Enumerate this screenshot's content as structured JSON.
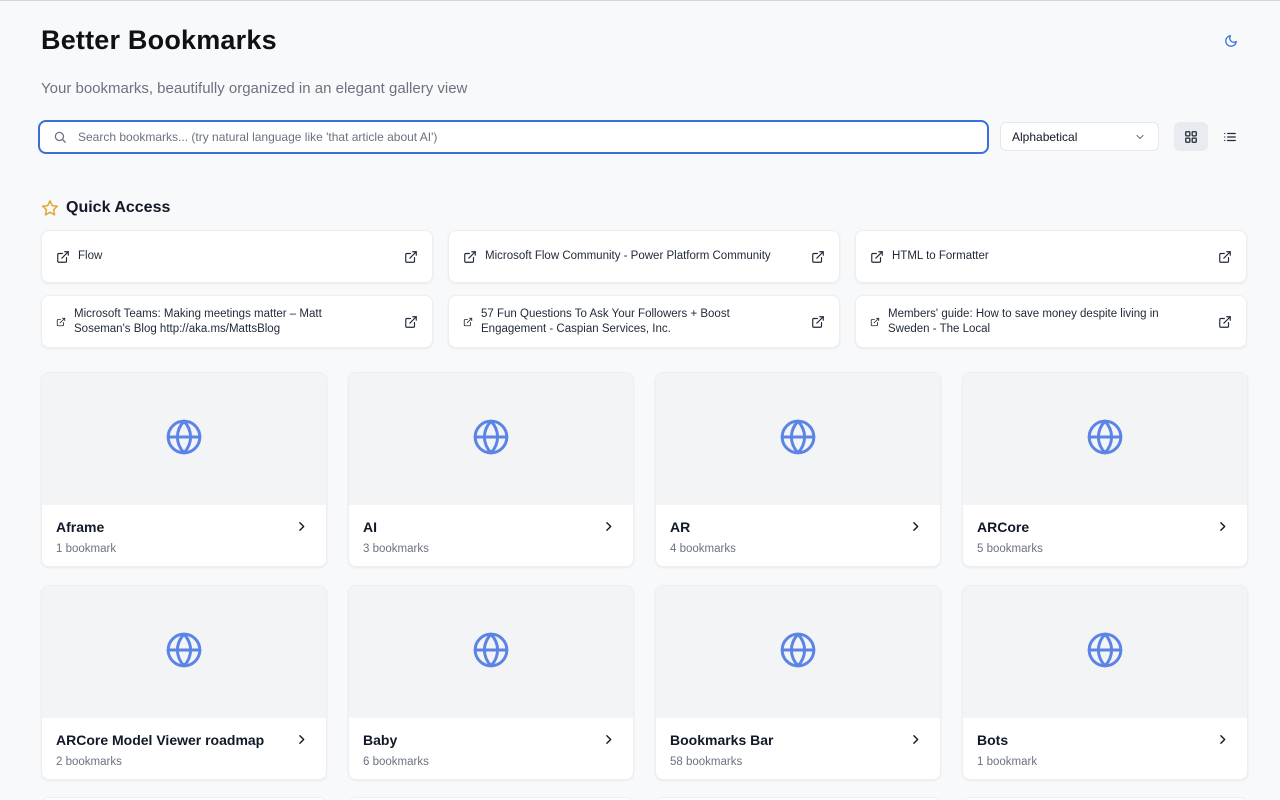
{
  "app": {
    "title": "Better Bookmarks",
    "subtitle": "Your bookmarks, beautifully organized in an elegant gallery view"
  },
  "search": {
    "placeholder": "Search bookmarks... (try natural language like 'that article about AI')",
    "value": ""
  },
  "sort": {
    "selected": "Alphabetical"
  },
  "view_mode": {
    "active": "grid",
    "options": [
      "grid",
      "list"
    ]
  },
  "icons": {
    "theme_toggle": "moon-icon",
    "search": "search-icon",
    "sort": "chevron-down-icon",
    "grid_view": "grid-icon",
    "list_view": "list-icon",
    "quick_access": "star-icon",
    "link": "external-link-icon",
    "folder": "globe-icon",
    "folder_open": "chevron-right-icon"
  },
  "colors": {
    "accent": "#3b6fd8",
    "globe": "#5b84e6",
    "star": "#e0a82e",
    "background": "#f8f9fa"
  },
  "quick_access": {
    "title": "Quick Access",
    "items": [
      {
        "label": "Flow"
      },
      {
        "label": "Microsoft Flow Community - Power Platform Community"
      },
      {
        "label": "HTML to Formatter"
      },
      {
        "label": "Microsoft Teams: Making meetings matter – Matt Soseman's Blog http://aka.ms/MattsBlog"
      },
      {
        "label": "57 Fun Questions To Ask Your Followers + Boost Engagement - Caspian Services, Inc."
      },
      {
        "label": "Members' guide: How to save money despite living in Sweden - The Local"
      }
    ]
  },
  "folders": [
    {
      "name": "Aframe",
      "count": "1 bookmark"
    },
    {
      "name": "AI",
      "count": "3 bookmarks"
    },
    {
      "name": "AR",
      "count": "4 bookmarks"
    },
    {
      "name": "ARCore",
      "count": "5 bookmarks"
    },
    {
      "name": "ARCore Model Viewer roadmap",
      "count": "2 bookmarks"
    },
    {
      "name": "Baby",
      "count": "6 bookmarks"
    },
    {
      "name": "Bookmarks Bar",
      "count": "58 bookmarks"
    },
    {
      "name": "Bots",
      "count": "1 bookmark"
    }
  ]
}
